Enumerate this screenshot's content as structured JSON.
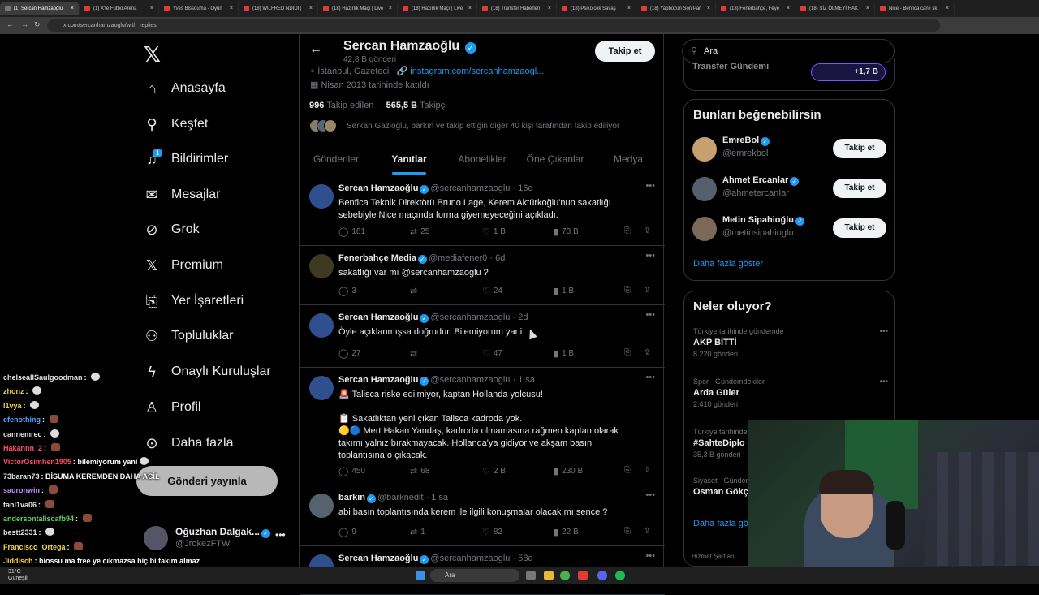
{
  "browser": {
    "tabs": [
      {
        "label": "(1) Sercan Hamzaoğlu",
        "active": true
      },
      {
        "label": "(1) X'te FutbolArena",
        "active": false
      },
      {
        "label": "Yves Bissouma - Oyun",
        "active": false
      },
      {
        "label": "(18) WILFRED NDIDI |",
        "active": false
      },
      {
        "label": "(18) Hazırlık Maçı | Live",
        "active": false
      },
      {
        "label": "(18) Hazırlık Maçı | Live",
        "active": false
      },
      {
        "label": "(18) Transfer Haberleri",
        "active": false
      },
      {
        "label": "(18) Psikolojik Savaş",
        "active": false
      },
      {
        "label": "(18) Yapbozun Son Par",
        "active": false
      },
      {
        "label": "(18) Fenerbahçe, Feye",
        "active": false
      },
      {
        "label": "(18) SİZ ÖLMEYİ HAK",
        "active": false
      },
      {
        "label": "Nice - Benfica canlı sk",
        "active": false
      }
    ],
    "url": "x.com/sercanhamzaoglu/with_replies"
  },
  "nav": {
    "items": [
      {
        "label": "Anasayfa",
        "icon": "home-icon"
      },
      {
        "label": "Keşfet",
        "icon": "search-icon"
      },
      {
        "label": "Bildirimler",
        "icon": "bell-icon",
        "badge": "1"
      },
      {
        "label": "Mesajlar",
        "icon": "mail-icon"
      },
      {
        "label": "Grok",
        "icon": "grok-icon"
      },
      {
        "label": "Premium",
        "icon": "x-premium-icon"
      },
      {
        "label": "Yer İşaretleri",
        "icon": "bookmark-icon"
      },
      {
        "label": "Topluluklar",
        "icon": "communities-icon"
      },
      {
        "label": "Onaylı Kuruluşlar",
        "icon": "lightning-icon"
      },
      {
        "label": "Profil",
        "icon": "person-icon"
      },
      {
        "label": "Daha fazla",
        "icon": "more-circle-icon"
      }
    ],
    "post_button": "Gönderi yayınla",
    "me": {
      "name": "Oğuzhan Dalgak...",
      "handle": "@JrokezFTW"
    }
  },
  "profile": {
    "name": "Sercan Hamzaoğlu",
    "post_count": "42,8 B gönderi",
    "follow_label": "Takip et",
    "location": "İstanbul, Gazeteci",
    "link": "instagram.com/sercanhamzaogl...",
    "joined": "Nisan 2013 tarihinde katıldı",
    "following_count": "996",
    "following_label": "Takip edilen",
    "followers_count": "565,5 B",
    "followers_label": "Takipçi",
    "known_followers": "Serkan Gazioğlu, barkın ve takip ettiğin diğer 40 kişi tarafından takip ediliyor"
  },
  "tabs": [
    "Gönderiler",
    "Yanıtlar",
    "Abonelikler",
    "Öne Çıkanlar",
    "Medya"
  ],
  "active_tab": "Yanıtlar",
  "tweets": [
    {
      "name": "Sercan Hamzaoğlu",
      "handle": "@sercanhamzaoglu",
      "time": "16d",
      "lines": [
        "Benfica Teknik Direktörü Bruno Lage, Kerem Aktürkoğlu'nun sakatlığı",
        "sebebiyle Nice maçında forma giyemeyeceğini açıkladı."
      ],
      "replies": "181",
      "reposts": "25",
      "likes": "1 B",
      "views": "73 B"
    },
    {
      "name": "Fenerbahçe Media",
      "handle": "@mediafener0",
      "time": "6d",
      "lines": [
        "sakatlığı var mı @sercanhamzaoglu ?"
      ],
      "replies": "3",
      "reposts": "",
      "likes": "24",
      "views": "1 B"
    },
    {
      "name": "Sercan Hamzaoğlu",
      "handle": "@sercanhamzaoglu",
      "time": "2d",
      "lines": [
        "Öyle açıklanmışsa doğrudur. Bilemiyorum yani"
      ],
      "replies": "27",
      "reposts": "",
      "likes": "47",
      "views": "1 B"
    },
    {
      "name": "Sercan Hamzaoğlu",
      "handle": "@sercanhamzaoglu",
      "time": "1 sa",
      "lines": [
        "🚨 Talisca riske edilmiyor, kaptan Hollanda yolcusu!",
        "",
        "📋 Sakatlıktan yeni çıkan Talisca kadroda yok.",
        "🟡🔵 Mert Hakan Yandaş, kadroda olmamasına rağmen kaptan olarak",
        "takımı yalnız bırakmayacak. Hollanda'ya gidiyor ve akşam basın",
        "toplantısına o çıkacak."
      ],
      "replies": "450",
      "reposts": "68",
      "likes": "2 B",
      "views": "230 B"
    },
    {
      "name": "barkın",
      "handle": "@barknedit",
      "time": "1 sa",
      "lines": [
        "abi basın toplantısında kerem ile ilgili konuşmalar olacak mı sence ?"
      ],
      "replies": "9",
      "reposts": "1",
      "likes": "82",
      "views": "22 B"
    },
    {
      "name": "Sercan Hamzaoğlu",
      "handle": "@sercanhamzaoglu",
      "time": "58d",
      "lines": [],
      "replies": "",
      "reposts": "",
      "likes": "",
      "views": ""
    }
  ],
  "right": {
    "search_placeholder": "Ara",
    "transfer_label": "Transfer Gündemi",
    "transfer_count": "+1,7 B",
    "suggest_title": "Bunları beğenebilirsin",
    "suggestions": [
      {
        "name": "EmreBol",
        "handle": "@emrekbol",
        "button": "Takip et"
      },
      {
        "name": "Ahmet Ercanlar",
        "handle": "@ahmetercanIar",
        "button": "Takip et"
      },
      {
        "name": "Metin Sipahioğlu",
        "handle": "@metinsipahioglu",
        "button": "Takip et"
      }
    ],
    "show_more": "Daha fazla göster",
    "trends_title": "Neler oluyor?",
    "trends": [
      {
        "context": "Türkiye tarihinde gündemde",
        "topic": "AKP BİTTİ",
        "posts": "8.220 gönderi"
      },
      {
        "context": "Spor · Gündemdekiler",
        "topic": "Arda Güler",
        "posts": "2.410 gönderi"
      },
      {
        "context": "Türkiye tarihinde gündemde",
        "topic": "#SahteDiplo",
        "posts": "35,3 B gönderi"
      },
      {
        "context": "Siyaset · Gündemde",
        "topic": "Osman Gökç",
        "posts": ""
      }
    ],
    "show_more_2": "Daha fazla gö",
    "footer": "Hizmet Şartları"
  },
  "chat": [
    {
      "user": "chelseaIISaulgoodman",
      "color": "#e0e0e0",
      "msg": "",
      "emote": "w"
    },
    {
      "user": "zhonz",
      "color": "#f2d43d",
      "msg": "",
      "emote": "w"
    },
    {
      "user": "l1vya",
      "color": "#f2d43d",
      "msg": "",
      "emote": "w"
    },
    {
      "user": "efenothing",
      "color": "#4da3ff",
      "msg": "",
      "emote": "r"
    },
    {
      "user": "cannemrec",
      "color": "#e0e0e0",
      "msg": "",
      "emote": "w"
    },
    {
      "user": "Hakannn_2",
      "color": "#ff4d6a",
      "msg": "",
      "emote": "r"
    },
    {
      "user": "VictorOsimhen1905",
      "color": "#ff4d6a",
      "msg": "bilemiyorum yani",
      "emote": "w"
    },
    {
      "user": "73baran73",
      "color": "#e0e0e0",
      "msg": "BİSUMA KEREMDEN DAHA ACİL",
      "emote": ""
    },
    {
      "user": "sauronwin",
      "color": "#c58cff",
      "msg": "",
      "emote": "r"
    },
    {
      "user": "tanl1va06",
      "color": "#e0e0e0",
      "msg": "",
      "emote": "r"
    },
    {
      "user": "andersontaliscafb94",
      "color": "#5fd35f",
      "msg": "",
      "emote": "r"
    },
    {
      "user": "bestt2331",
      "color": "#e0e0e0",
      "msg": "",
      "emote": "w"
    },
    {
      "user": "Francisco_Ortega",
      "color": "#f2d43d",
      "msg": "",
      "emote": "r"
    },
    {
      "user": "Jiddisch",
      "color": "#f2d43d",
      "msg": "biossu ma free ye cıkmazsa hiç bi takım almaz",
      "emote": ""
    }
  ],
  "taskbar": {
    "search": "Ara",
    "weather_temp": "31°C",
    "weather_text": "Güneşli"
  }
}
